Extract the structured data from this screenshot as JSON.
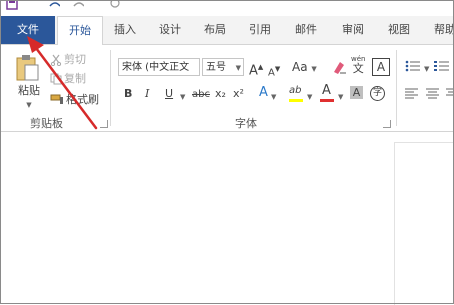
{
  "tabs": {
    "file": "文件",
    "home": "开始",
    "insert": "插入",
    "design": "设计",
    "layout": "布局",
    "references": "引用",
    "mailings": "邮件",
    "review": "审阅",
    "view": "视图",
    "help": "帮助"
  },
  "clipboard": {
    "paste": "粘贴",
    "cut": "剪切",
    "copy": "复制",
    "format_painter": "格式刷",
    "group_label": "剪贴板"
  },
  "font": {
    "font_name": "宋体 (中文正文",
    "font_size": "五号",
    "grow": "A",
    "shrink": "A",
    "case": "Aa",
    "phonetic_top": "wén",
    "phonetic_bottom": "文",
    "char_border": "A",
    "bold": "B",
    "italic": "I",
    "underline": "U",
    "strikethrough": "abc",
    "subscript": "x₂",
    "superscript": "x²",
    "text_effects": "A",
    "highlight": "ab",
    "font_color": "A",
    "char_shading": "A",
    "enclose": "字",
    "group_label": "字体"
  },
  "colors": {
    "file_tab_bg": "#2b579a",
    "accent": "#2b579a",
    "arrow": "#d62a2a",
    "highlight": "#ffff00",
    "font_color": "#e03030"
  }
}
